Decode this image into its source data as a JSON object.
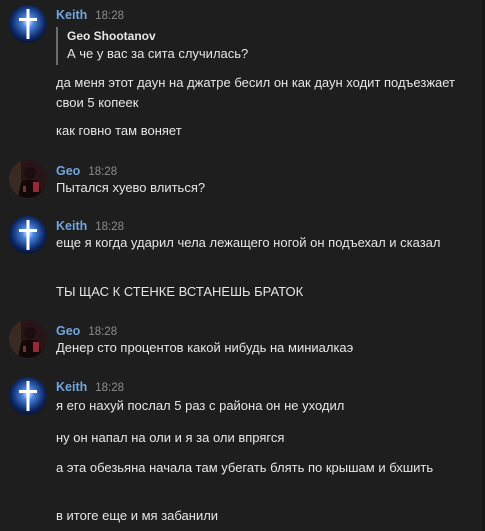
{
  "messages": [
    {
      "author": "Keith",
      "time": "18:28",
      "avatar_icon": "glowing-cross-icon",
      "quote": {
        "author": "Geo Shootanov",
        "text": "А че у вас за сита случилась?"
      },
      "lines": [
        "да меня этот даун на джатре бесил он как даун ходит подъезжает свои 5 копеек",
        "как говно там воняет"
      ]
    },
    {
      "author": "Geo",
      "time": "18:28",
      "avatar_icon": "dark-figure-avatar-icon",
      "lines": [
        "Пытался хуево влиться?"
      ]
    },
    {
      "author": "Keith",
      "time": "18:28",
      "avatar_icon": "glowing-cross-icon",
      "lines": [
        "еще я когда ударил чела лежащего ногой он подъехал и сказал",
        "ТЫ ЩАС К СТЕНКЕ ВСТАНЕШЬ БРАТОК"
      ]
    },
    {
      "author": "Geo",
      "time": "18:28",
      "avatar_icon": "dark-figure-avatar-icon",
      "lines": [
        "Денер сто процентов какой нибудь на миниалкаэ"
      ]
    },
    {
      "author": "Keith",
      "time": "18:28",
      "avatar_icon": "glowing-cross-icon",
      "lines": [
        "я его нахуй послал 5 раз с района он не уходил",
        "ну он напал на оли и я за оли впрягся",
        "а эта обезьяна начала там убегать блять по крышам и бхшить",
        "в итоге еще и мя забанили"
      ]
    }
  ],
  "colors": {
    "background": "#1e1e1e",
    "author_name": "#72a5de",
    "timestamp": "#8c8c8c",
    "text": "#e6e6e6"
  }
}
